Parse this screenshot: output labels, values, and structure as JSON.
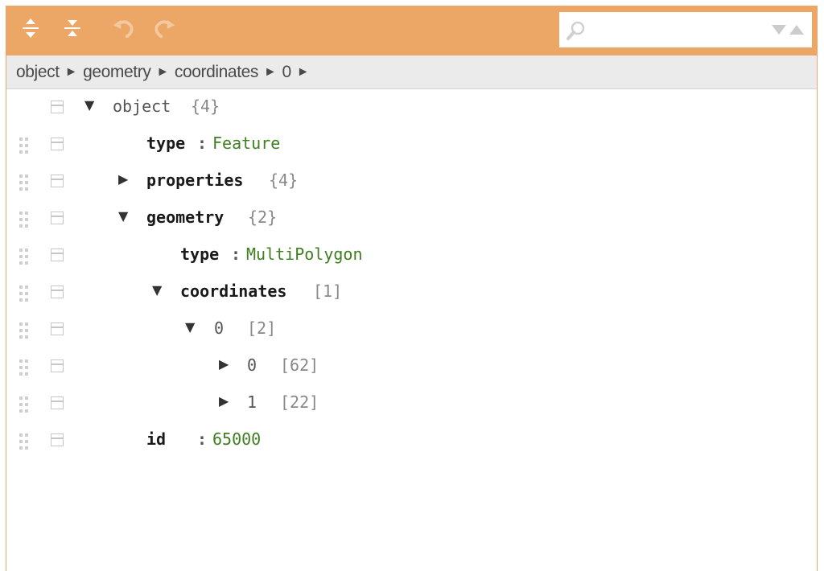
{
  "toolbar": {
    "search": {
      "value": "",
      "placeholder": ""
    },
    "accent_color": "#eca666",
    "icons": [
      "expand-all-icon",
      "collapse-all-icon",
      "undo-icon",
      "redo-icon",
      "search-icon",
      "previous-result-icon",
      "next-result-icon"
    ]
  },
  "breadcrumb": [
    "object",
    "geometry",
    "coordinates",
    "0"
  ],
  "breadcrumb_separator": "►",
  "tree": {
    "root": {
      "field": "object",
      "meta": "{4}"
    },
    "type": {
      "field": "type",
      "value": "Feature"
    },
    "properties": {
      "field": "properties",
      "meta": "{4}"
    },
    "geometry": {
      "field": "geometry",
      "meta": "{2}"
    },
    "geometry_type": {
      "field": "type",
      "value": "MultiPolygon"
    },
    "coordinates": {
      "field": "coordinates",
      "meta": "[1]"
    },
    "coord_0": {
      "index": "0",
      "meta": "[2]"
    },
    "coord_0_0": {
      "index": "0",
      "meta": "[62]"
    },
    "coord_0_1": {
      "index": "1",
      "meta": "[22]"
    },
    "id": {
      "field": "id",
      "value": "65000"
    }
  },
  "separator": ":",
  "value_color": "#3f7f21"
}
